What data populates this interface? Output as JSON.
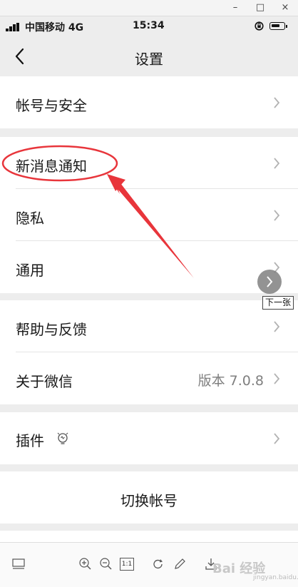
{
  "window": {
    "minimize": "–",
    "maximize": "□",
    "close": "×"
  },
  "status_bar": {
    "carrier": "中国移动 4G",
    "time": "15:34"
  },
  "nav": {
    "title": "设置"
  },
  "rows": {
    "account_security": "帐号与安全",
    "new_message_notification": "新消息通知",
    "privacy": "隐私",
    "general": "通用",
    "help_feedback": "帮助与反馈",
    "about_wechat": "关于微信",
    "about_wechat_version": "版本 7.0.8",
    "plugins": "插件",
    "switch_account": "切换帐号"
  },
  "overlay": {
    "next_tooltip": "下一张"
  },
  "viewer_toolbar": {
    "zoom_ratio": "1:1",
    "watermark": "Bai 经验",
    "watermark_sub": "jingyan.baidu.com"
  },
  "colors": {
    "annotation_red": "#e8353b",
    "background": "#ededed",
    "row_bg": "#ffffff",
    "chevron": "#b2b2b2"
  },
  "icons": [
    "back-icon",
    "chevron-right-icon",
    "bulb-icon",
    "lock-rotation-icon",
    "battery-icon",
    "signal-icon"
  ]
}
